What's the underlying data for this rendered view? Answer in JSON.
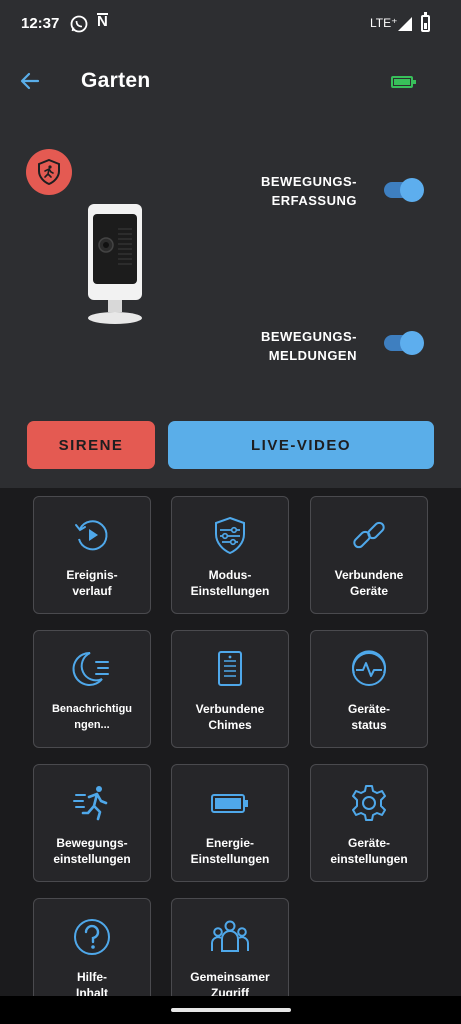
{
  "status_bar": {
    "time": "12:37",
    "network": "LTE⁺",
    "icons": [
      "whatsapp-icon",
      "n-icon",
      "signal-icon",
      "battery-icon"
    ]
  },
  "app_bar": {
    "back_icon": "arrow-left-icon",
    "title": "Garten",
    "battery_icon": "battery-full-icon",
    "battery_color": "#38c05a"
  },
  "device": {
    "mode_icon": "shield-motion-icon",
    "mode_color": "#e45a52",
    "image": "ring-stick-up-cam"
  },
  "toggles": [
    {
      "label": "BEWEGUNGS-\nERFASSUNG",
      "on": true
    },
    {
      "label": "BEWEGUNGS-\nMELDUNGEN",
      "on": true
    }
  ],
  "actions": {
    "siren_label": "SIRENE",
    "live_label": "LIVE-VIDEO"
  },
  "tiles": [
    {
      "icon": "history-icon",
      "label": "Ereignis-\nverlauf"
    },
    {
      "icon": "mode-settings-icon",
      "label": "Modus-\nEinstellungen"
    },
    {
      "icon": "link-icon",
      "label": "Verbundene\nGeräte"
    },
    {
      "icon": "moon-notifications-icon",
      "label": "Benachrichtigu\nngen..."
    },
    {
      "icon": "chime-icon",
      "label": "Verbundene\nChimes"
    },
    {
      "icon": "pulse-icon",
      "label": "Geräte-\nstatus"
    },
    {
      "icon": "running-person-icon",
      "label": "Bewegungs-\neinstellungen"
    },
    {
      "icon": "battery-icon",
      "label": "Energie-\nEinstellungen"
    },
    {
      "icon": "gear-icon",
      "label": "Geräte-\neinstellungen"
    },
    {
      "icon": "help-icon",
      "label": "Hilfe-\nInhalt"
    },
    {
      "icon": "group-icon",
      "label": "Gemeinsamer\nZugriff"
    }
  ],
  "colors": {
    "accent_blue": "#5aaee9",
    "siren_red": "#e45a52",
    "icon_blue": "#4fa8ea"
  }
}
